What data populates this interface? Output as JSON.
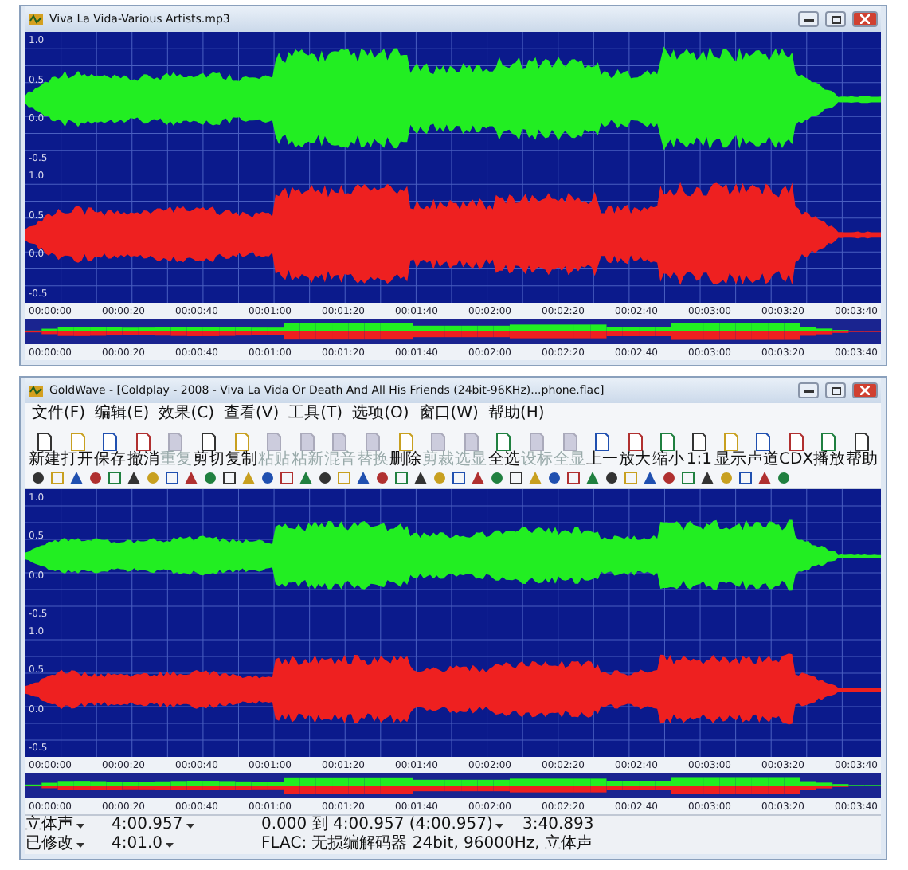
{
  "windows": [
    {
      "kind": "file",
      "title": "Viva La Vida-Various Artists.mp3",
      "channels": [
        {
          "color": "#22ee22",
          "labels": [
            "1.0",
            "0.5",
            "0.0",
            "-0.5"
          ]
        },
        {
          "color": "#ee2020",
          "labels": [
            "1.0",
            "0.5",
            "0.0",
            "-0.5"
          ]
        }
      ],
      "time_labels": [
        "00:00:00",
        "00:00:20",
        "00:00:40",
        "00:01:00",
        "00:01:20",
        "00:01:40",
        "00:02:00",
        "00:02:20",
        "00:02:40",
        "00:03:00",
        "00:03:20",
        "00:03:40"
      ],
      "overview_labels": [
        "00:00:00",
        "00:00:20",
        "00:00:40",
        "00:01:00",
        "00:01:20",
        "00:01:40",
        "00:02:00",
        "00:02:20",
        "00:02:40",
        "00:03:00",
        "00:03:20",
        "00:03:40"
      ]
    },
    {
      "kind": "app",
      "title": "GoldWave - [Coldplay - 2008 - Viva La Vida Or Death And All His Friends (24bit-96KHz)...phone.flac]",
      "menu": [
        "文件(F)",
        "编辑(E)",
        "效果(C)",
        "查看(V)",
        "工具(T)",
        "选项(O)",
        "窗口(W)",
        "帮助(H)"
      ],
      "toolbar": [
        {
          "label": "新建",
          "disabled": false
        },
        {
          "label": "打开",
          "disabled": false
        },
        {
          "label": "保存",
          "disabled": false
        },
        {
          "label": "撤消",
          "disabled": false
        },
        {
          "label": "重复",
          "disabled": true
        },
        {
          "label": "剪切",
          "disabled": false
        },
        {
          "label": "复制",
          "disabled": false
        },
        {
          "label": "粘贴",
          "disabled": true
        },
        {
          "label": "粘新",
          "disabled": true
        },
        {
          "label": "混音",
          "disabled": true
        },
        {
          "label": "替换",
          "disabled": true
        },
        {
          "label": "删除",
          "disabled": false
        },
        {
          "label": "剪裁",
          "disabled": true
        },
        {
          "label": "选显",
          "disabled": true
        },
        {
          "label": "全选",
          "disabled": false
        },
        {
          "label": "设标",
          "disabled": true
        },
        {
          "label": "全显",
          "disabled": true
        },
        {
          "label": "上一",
          "disabled": false
        },
        {
          "label": "放大",
          "disabled": false
        },
        {
          "label": "缩小",
          "disabled": false
        },
        {
          "label": "1:1",
          "disabled": false
        },
        {
          "label": "显示",
          "disabled": false
        },
        {
          "label": "声道",
          "disabled": false
        },
        {
          "label": "CDX",
          "disabled": false
        },
        {
          "label": "播放",
          "disabled": false
        },
        {
          "label": "帮助",
          "disabled": false
        }
      ],
      "channels": [
        {
          "color": "#22ee22",
          "labels": [
            "1.0",
            "0.5",
            "0.0",
            "-0.5"
          ]
        },
        {
          "color": "#ee2020",
          "labels": [
            "1.0",
            "0.5",
            "0.0",
            "-0.5"
          ]
        }
      ],
      "time_labels": [
        "00:00:00",
        "00:00:20",
        "00:00:40",
        "00:01:00",
        "00:01:20",
        "00:01:40",
        "00:02:00",
        "00:02:20",
        "00:02:40",
        "00:03:00",
        "00:03:20",
        "00:03:40"
      ],
      "overview_labels": [
        "00:00:00",
        "00:00:20",
        "00:00:40",
        "00:01:00",
        "00:01:20",
        "00:01:40",
        "00:02:00",
        "00:02:20",
        "00:02:40",
        "00:03:00",
        "00:03:20",
        "00:03:40"
      ],
      "status": [
        [
          "立体声",
          "4:00.957",
          "0.000 到 4:00.957 (4:00.957)",
          "3:40.893"
        ],
        [
          "已修改",
          "4:01.0",
          "FLAC: 无损编解码器 24bit, 96000Hz, 立体声"
        ]
      ]
    }
  ]
}
